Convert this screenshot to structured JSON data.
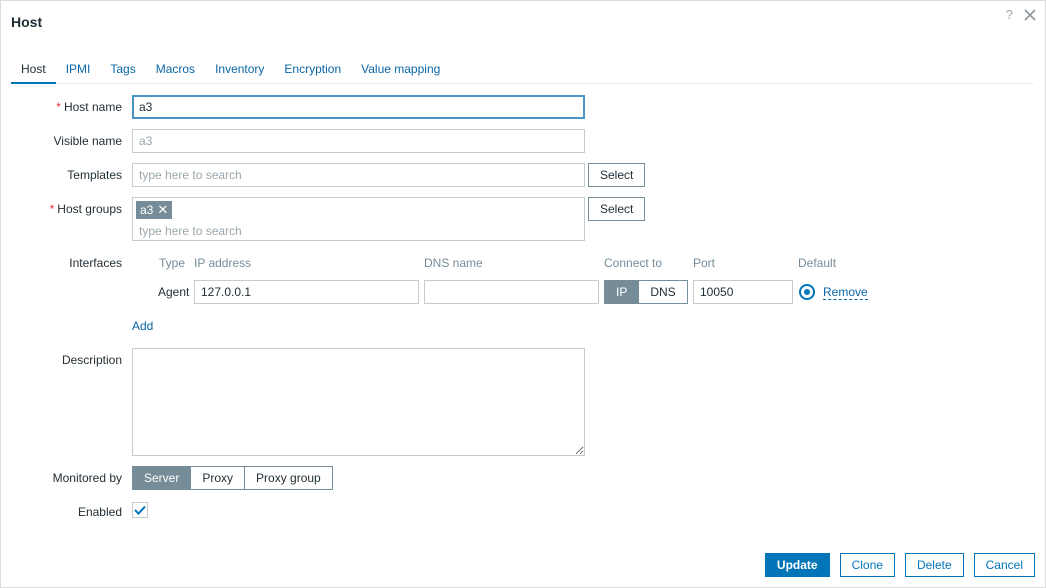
{
  "dialog": {
    "title": "Host"
  },
  "header": {
    "help": "?",
    "close": "close-icon"
  },
  "tabs": [
    {
      "label": "Host",
      "active": true
    },
    {
      "label": "IPMI"
    },
    {
      "label": "Tags"
    },
    {
      "label": "Macros"
    },
    {
      "label": "Inventory"
    },
    {
      "label": "Encryption"
    },
    {
      "label": "Value mapping"
    }
  ],
  "form": {
    "host_name": {
      "label": "Host name",
      "required": "*",
      "value": "a3"
    },
    "visible_name": {
      "label": "Visible name",
      "placeholder": "a3"
    },
    "templates": {
      "label": "Templates",
      "placeholder": "type here to search",
      "select": "Select"
    },
    "host_groups": {
      "label": "Host groups",
      "required": "*",
      "chip": "a3",
      "placeholder": "type here to search",
      "select": "Select"
    },
    "interfaces": {
      "label": "Interfaces",
      "headers": {
        "type": "Type",
        "ip": "IP address",
        "dns": "DNS name",
        "connect": "Connect to",
        "port": "Port",
        "default": "Default"
      },
      "row": {
        "type": "Agent",
        "ip": "127.0.0.1",
        "dns": "",
        "connect_ip": "IP",
        "connect_dns": "DNS",
        "port": "10050",
        "remove": "Remove"
      },
      "add": "Add"
    },
    "description": {
      "label": "Description",
      "value": ""
    },
    "monitored_by": {
      "label": "Monitored by",
      "options": [
        "Server",
        "Proxy",
        "Proxy group"
      ],
      "selected": "Server"
    },
    "enabled": {
      "label": "Enabled",
      "checked": true
    }
  },
  "footer": {
    "update": "Update",
    "clone": "Clone",
    "delete": "Delete",
    "cancel": "Cancel"
  },
  "colors": {
    "accent": "#0275b8",
    "link": "#0a66a6",
    "required": "#e33734",
    "selected_segment": "#768d99"
  }
}
